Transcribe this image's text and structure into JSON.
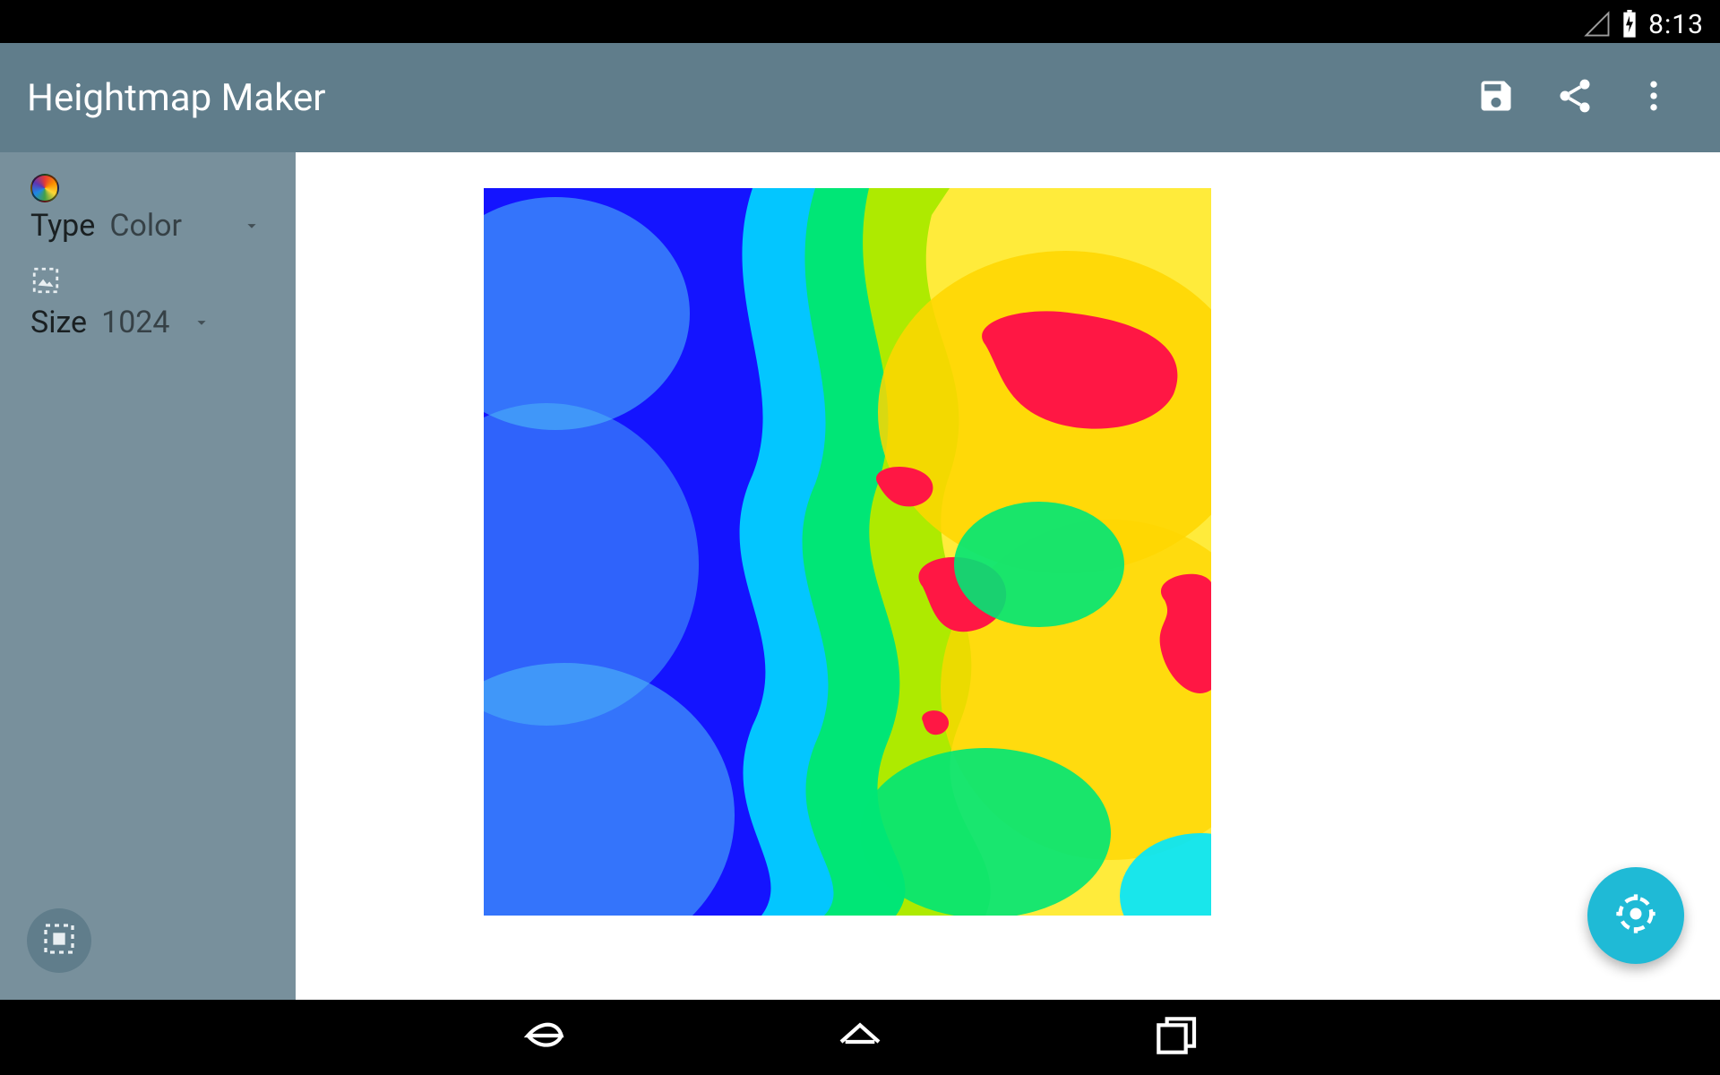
{
  "status": {
    "clock": "8:13",
    "battery_icon": "battery-charging-icon",
    "signal_icon": "signal-empty-icon"
  },
  "action_bar": {
    "title": "Heightmap Maker",
    "save_icon": "save-icon",
    "share_icon": "share-icon",
    "overflow_icon": "overflow-menu-icon"
  },
  "sidebar": {
    "type": {
      "label": "Type",
      "value": "Color",
      "icon": "color-wheel-icon"
    },
    "size": {
      "label": "Size",
      "value": "1024",
      "icon": "image-crop-icon"
    },
    "fab_icon": "select-all-icon"
  },
  "main": {
    "preview": "heightmap-preview",
    "fab_icon": "regenerate-icon"
  },
  "nav": {
    "back_icon": "back-icon",
    "home_icon": "home-icon",
    "recents_icon": "recents-icon"
  },
  "colors": {
    "primary": "#607d8b",
    "primary_light": "#78909c",
    "accent": "#1fbad6"
  }
}
